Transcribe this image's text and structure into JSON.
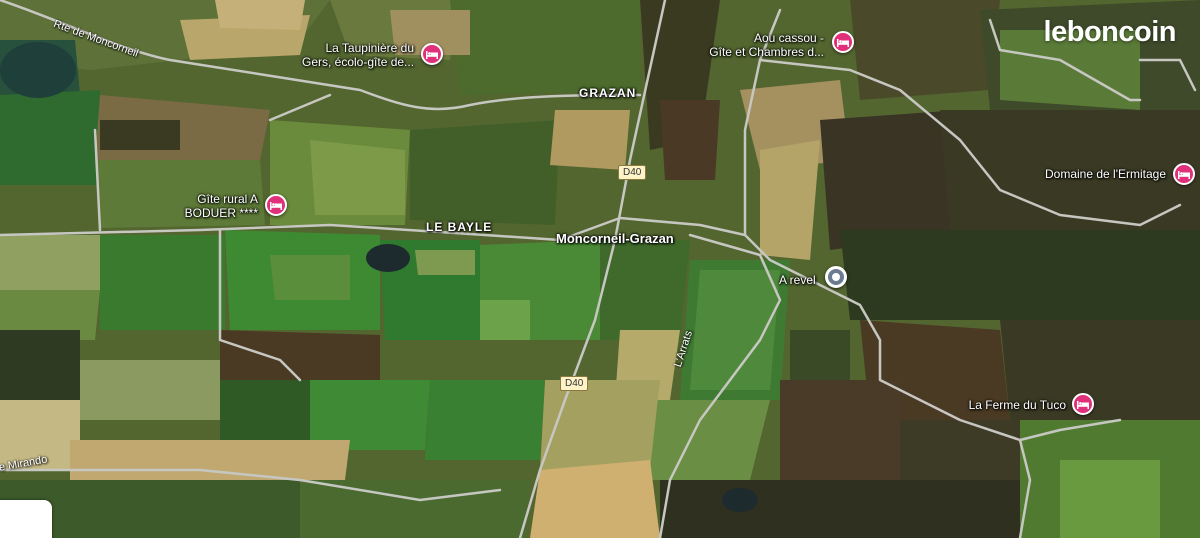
{
  "brand": {
    "logo_text": "leboncoin"
  },
  "colors": {
    "pin": "#e0307a",
    "place_marker": "#6c7b8f"
  },
  "villages": {
    "grazan": "GRAZAN",
    "le_bayle": "LE BAYLE",
    "moncorneil": "Moncorneil-Grazan",
    "a_revel": "A revel"
  },
  "roads": {
    "d40_north": "D40",
    "d40_south": "D40",
    "rte_moncorneil": "Rte de Moncorneil",
    "larrats": "L'Arrats",
    "mirando": "e Mirando"
  },
  "listings": [
    {
      "line1": "La Taupinière du",
      "line2": "Gers, écolo-gîte de...",
      "icon": "bed-icon"
    },
    {
      "line1": "Aou cassou -",
      "line2": "Gîte et Chambres d...",
      "icon": "bed-icon"
    },
    {
      "line1": "Gîte rural A",
      "line2": "BODUER ****",
      "icon": "bed-icon"
    },
    {
      "line1": "Domaine de l'Ermitage",
      "line2": "",
      "icon": "bed-icon"
    },
    {
      "line1": "La Ferme du Tuco",
      "line2": "",
      "icon": "bed-icon"
    }
  ]
}
